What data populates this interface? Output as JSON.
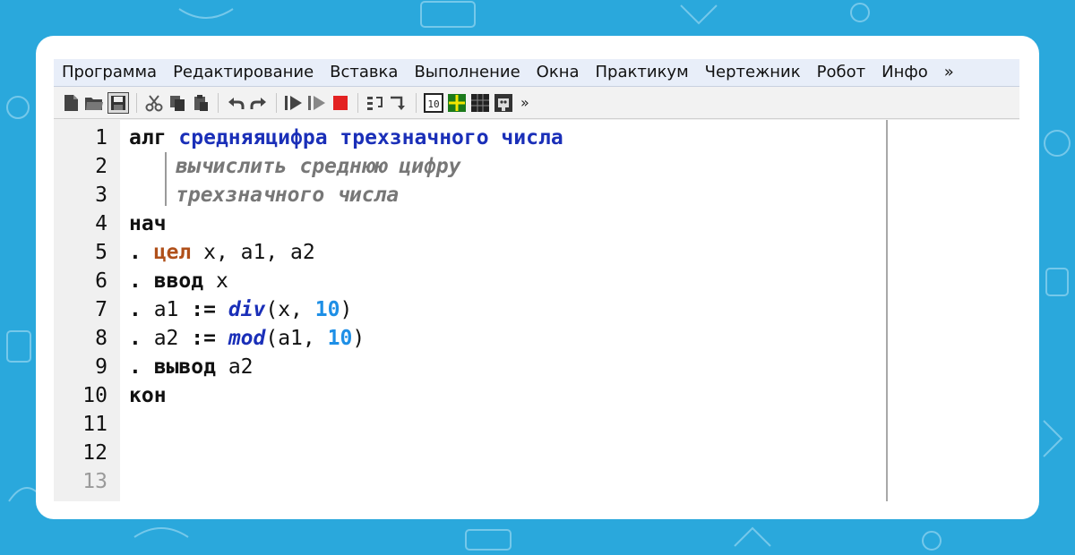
{
  "colors": {
    "background": "#2aa8dc",
    "card": "#ffffff",
    "keyword_name": "#1a2fb8",
    "keyword_type": "#b0501a",
    "number": "#1e8fe6",
    "comment": "#777777"
  },
  "menu": [
    "Программа",
    "Редактирование",
    "Вставка",
    "Выполнение",
    "Окна",
    "Практикум",
    "Чертежник",
    "Робот",
    "Инфо",
    "»"
  ],
  "toolbar": {
    "icons": [
      "new-file-icon",
      "open-folder-icon",
      "save-icon",
      "cut-icon",
      "copy-icon",
      "paste-icon",
      "undo-icon",
      "redo-icon",
      "run-icon",
      "run-step-icon",
      "stop-icon",
      "step-into-icon",
      "step-out-icon",
      "counter-icon",
      "drawer-icon",
      "grid-icon",
      "robot-icon"
    ],
    "more_label": "»"
  },
  "editor": {
    "line_numbers": [
      "1",
      "2",
      "3",
      "4",
      "5",
      "6",
      "7",
      "8",
      "9",
      "10",
      "11",
      "12",
      "13"
    ],
    "line1": {
      "kw": "алг",
      "name": "средняяцифра трехзначного числа"
    },
    "line2": {
      "comment": "вычислить среднюю цифру"
    },
    "line3": {
      "comment": "трехзначного числа"
    },
    "line4": {
      "kw": "нач"
    },
    "line5": {
      "dot": ".",
      "type": "цел",
      "rest": " x, a1, a2"
    },
    "line6": {
      "dot": ".",
      "kw": "ввод",
      "rest": " x"
    },
    "line7": {
      "dot": ".",
      "lhs": " a1 ",
      "op": ":=",
      "fn": "div",
      "args": "(x, ",
      "num": "10",
      "close": ")"
    },
    "line8": {
      "dot": ".",
      "lhs": " a2 ",
      "op": ":=",
      "fn": "mod",
      "args": "(a1, ",
      "num": "10",
      "close": ")"
    },
    "line9": {
      "dot": ".",
      "kw": "вывод",
      "rest": " a2"
    },
    "line10": {
      "kw": "кон"
    }
  }
}
